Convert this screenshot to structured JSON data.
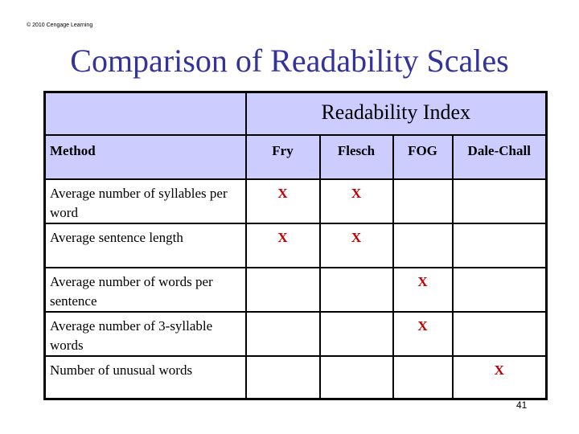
{
  "copyright": "© 2010 Cengage Learning",
  "title": "Comparison of Readability Scales",
  "table": {
    "group_header": "Readability Index",
    "columns": [
      "Method",
      "Fry",
      "Flesch",
      "FOG",
      "Dale-Chall"
    ],
    "rows": [
      {
        "method": "Average number of syllables per word",
        "fry": "X",
        "flesch": "X",
        "fog": "",
        "dale_chall": ""
      },
      {
        "method": "Average sentence length",
        "fry": "X",
        "flesch": "X",
        "fog": "",
        "dale_chall": ""
      },
      {
        "method": "Average number of words per sentence",
        "fry": "",
        "flesch": "",
        "fog": "X",
        "dale_chall": ""
      },
      {
        "method": "Average number of 3-syllable words",
        "fry": "",
        "flesch": "",
        "fog": "X",
        "dale_chall": ""
      },
      {
        "method": "Number of unusual words",
        "fry": "",
        "flesch": "",
        "fog": "",
        "dale_chall": "X"
      }
    ]
  },
  "colors": {
    "title": "#333399",
    "header_bg": "#ccccff",
    "mark": "#c00000"
  },
  "page_number": "41"
}
